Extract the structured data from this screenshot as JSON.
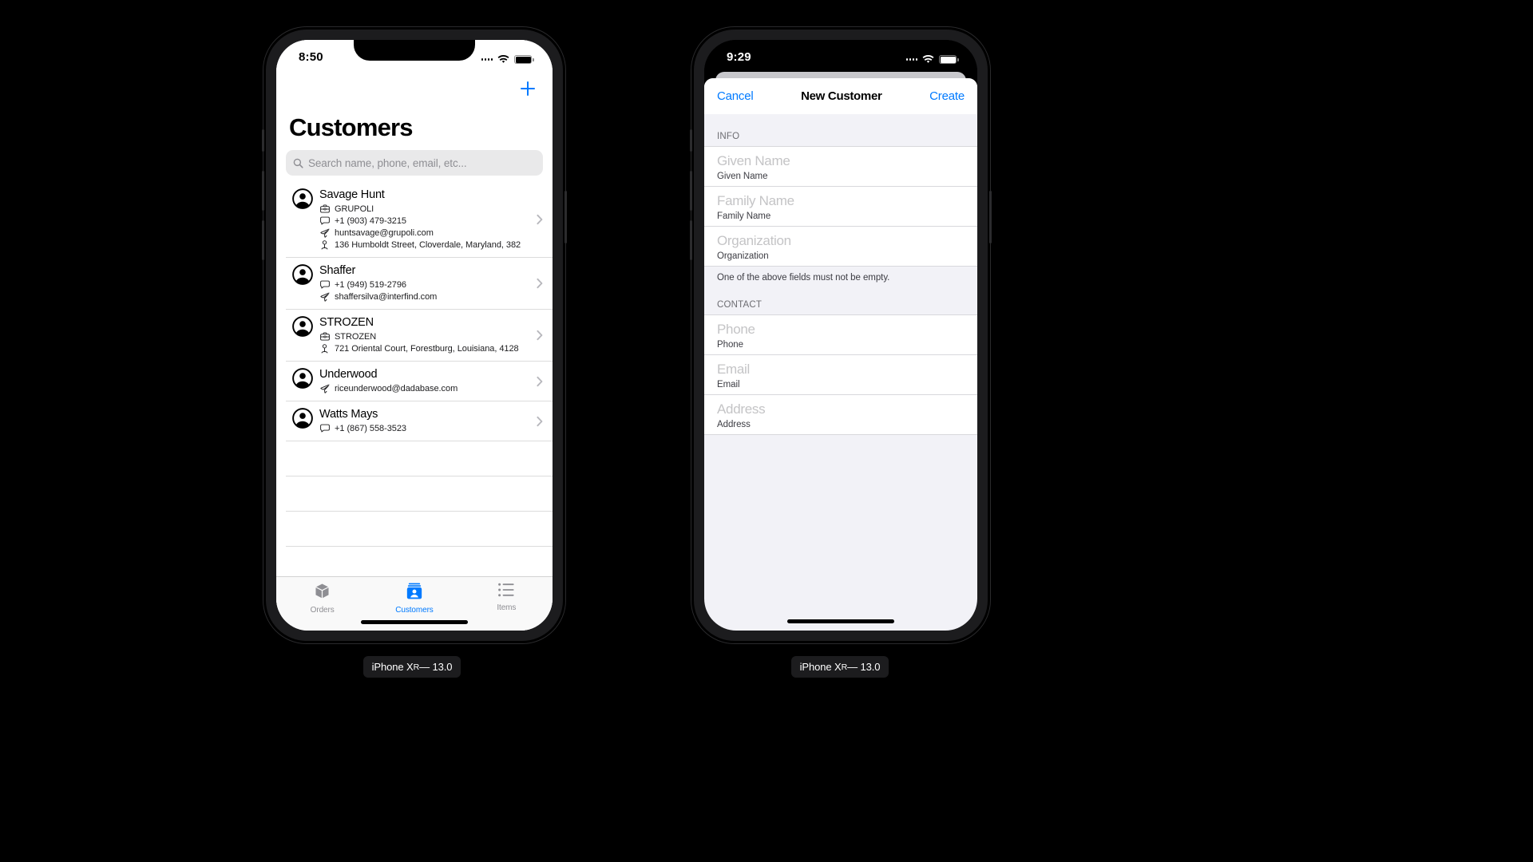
{
  "phones": [
    {
      "id": "customers-list",
      "caption": "iPhone Xʀ — 13.0",
      "caption_model": "iPhone X",
      "caption_sub": "R",
      "caption_tail": " — 13.0",
      "status": {
        "time": "8:50",
        "wifi_icon": "wifi-icon",
        "battery_icon": "battery-icon",
        "signal_icon": "signal-dots-icon"
      },
      "nav": {
        "add_icon": "plus-icon",
        "title": "Customers"
      },
      "search": {
        "icon": "search-icon",
        "placeholder": "Search name, phone, email, etc..."
      },
      "rows": [
        {
          "name": "Savage Hunt",
          "avatar_icon": "person-circle-icon",
          "chevron_icon": "chevron-right-icon",
          "details": [
            {
              "icon": "briefcase-icon",
              "text": "GRUPOLI"
            },
            {
              "icon": "message-icon",
              "text": "+1 (903) 479-3215"
            },
            {
              "icon": "paperplane-icon",
              "text": "huntsavage@grupoli.com"
            },
            {
              "icon": "location-icon",
              "text": "136 Humboldt Street, Cloverdale, Maryland, 382"
            }
          ]
        },
        {
          "name": "Shaffer",
          "avatar_icon": "person-circle-icon",
          "chevron_icon": "chevron-right-icon",
          "details": [
            {
              "icon": "message-icon",
              "text": "+1 (949) 519-2796"
            },
            {
              "icon": "paperplane-icon",
              "text": "shaffersilva@interfind.com"
            }
          ]
        },
        {
          "name": "STROZEN",
          "avatar_icon": "person-circle-icon",
          "chevron_icon": "chevron-right-icon",
          "details": [
            {
              "icon": "briefcase-icon",
              "text": "STROZEN"
            },
            {
              "icon": "location-icon",
              "text": "721 Oriental Court, Forestburg, Louisiana, 4128"
            }
          ]
        },
        {
          "name": "Underwood",
          "avatar_icon": "person-circle-icon",
          "chevron_icon": "chevron-right-icon",
          "details": [
            {
              "icon": "paperplane-icon",
              "text": "riceunderwood@dadabase.com"
            }
          ]
        },
        {
          "name": "Watts Mays",
          "avatar_icon": "person-circle-icon",
          "chevron_icon": "chevron-right-icon",
          "details": [
            {
              "icon": "message-icon",
              "text": "+1 (867) 558-3523"
            }
          ]
        }
      ],
      "empty_rows": 4,
      "tabs": [
        {
          "label": "Orders",
          "icon": "box-icon",
          "active": false
        },
        {
          "label": "Customers",
          "icon": "contact-card-icon",
          "active": true
        },
        {
          "label": "Items",
          "icon": "list-icon",
          "active": false
        }
      ]
    },
    {
      "id": "new-customer",
      "caption": "iPhone Xʀ — 13.0",
      "caption_model": "iPhone X",
      "caption_sub": "R",
      "caption_tail": " — 13.0",
      "status": {
        "time": "9:29",
        "wifi_icon": "wifi-icon",
        "battery_icon": "battery-icon",
        "signal_icon": "signal-dots-icon"
      },
      "nav": {
        "cancel": "Cancel",
        "title": "New Customer",
        "create": "Create"
      },
      "sections": [
        {
          "header": "INFO",
          "fields": [
            {
              "placeholder": "Given Name",
              "caption": "Given Name"
            },
            {
              "placeholder": "Family Name",
              "caption": "Family Name"
            },
            {
              "placeholder": "Organization",
              "caption": "Organization"
            }
          ],
          "footnote": "One of the above fields must not be empty."
        },
        {
          "header": "CONTACT",
          "fields": [
            {
              "placeholder": "Phone",
              "caption": "Phone"
            },
            {
              "placeholder": "Email",
              "caption": "Email"
            },
            {
              "placeholder": "Address",
              "caption": "Address"
            }
          ],
          "footnote": ""
        }
      ]
    }
  ],
  "colors": {
    "accent": "#007aff",
    "background": "#000000",
    "screen": "#ffffff",
    "group_bg": "#f2f2f7",
    "separator": "#dcdcdc",
    "placeholder": "#c4c4c6",
    "secondary_text": "#8e8e93",
    "tab_inactive": "#8e8e93"
  }
}
